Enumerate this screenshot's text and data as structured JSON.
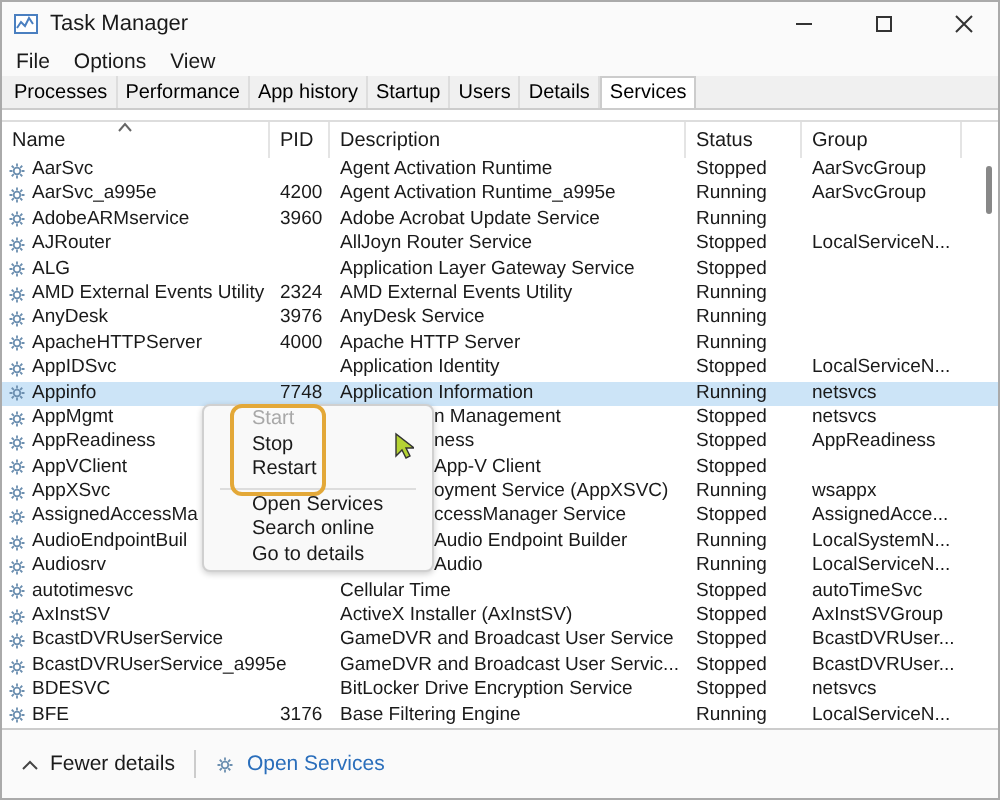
{
  "window": {
    "title": "Task Manager"
  },
  "menu_bar": [
    "File",
    "Options",
    "View"
  ],
  "tabs": [
    {
      "label": "Processes",
      "selected": false
    },
    {
      "label": "Performance",
      "selected": false
    },
    {
      "label": "App history",
      "selected": false
    },
    {
      "label": "Startup",
      "selected": false
    },
    {
      "label": "Users",
      "selected": false
    },
    {
      "label": "Details",
      "selected": false
    },
    {
      "label": "Services",
      "selected": true
    }
  ],
  "table": {
    "columns": [
      "Name",
      "PID",
      "Description",
      "Status",
      "Group"
    ],
    "rows": [
      {
        "name": "AarSvc",
        "pid": "",
        "description": "Agent Activation Runtime",
        "status": "Stopped",
        "group": "AarSvcGroup",
        "selected": false
      },
      {
        "name": "AarSvc_a995e",
        "pid": "4200",
        "description": "Agent Activation Runtime_a995e",
        "status": "Running",
        "group": "AarSvcGroup",
        "selected": false
      },
      {
        "name": "AdobeARMservice",
        "pid": "3960",
        "description": "Adobe Acrobat Update Service",
        "status": "Running",
        "group": "",
        "selected": false
      },
      {
        "name": "AJRouter",
        "pid": "",
        "description": "AllJoyn Router Service",
        "status": "Stopped",
        "group": "LocalServiceN...",
        "selected": false
      },
      {
        "name": "ALG",
        "pid": "",
        "description": "Application Layer Gateway Service",
        "status": "Stopped",
        "group": "",
        "selected": false
      },
      {
        "name": "AMD External Events Utility",
        "pid": "2324",
        "description": "AMD External Events Utility",
        "status": "Running",
        "group": "",
        "selected": false
      },
      {
        "name": "AnyDesk",
        "pid": "3976",
        "description": "AnyDesk Service",
        "status": "Running",
        "group": "",
        "selected": false
      },
      {
        "name": "ApacheHTTPServer",
        "pid": "4000",
        "description": "Apache HTTP Server",
        "status": "Running",
        "group": "",
        "selected": false
      },
      {
        "name": "AppIDSvc",
        "pid": "",
        "description": "Application Identity",
        "status": "Stopped",
        "group": "LocalServiceN...",
        "selected": false
      },
      {
        "name": "Appinfo",
        "pid": "7748",
        "description": "Application Information",
        "status": "Running",
        "group": "netsvcs",
        "selected": true
      },
      {
        "name": "AppMgmt",
        "pid": "",
        "description": "n Management",
        "status": "Stopped",
        "group": "netsvcs",
        "selected": false
      },
      {
        "name": "AppReadiness",
        "pid": "",
        "description": "ness",
        "status": "Stopped",
        "group": "AppReadiness",
        "selected": false
      },
      {
        "name": "AppVClient",
        "pid": "",
        "description": "App-V Client",
        "status": "Stopped",
        "group": "",
        "selected": false
      },
      {
        "name": "AppXSvc",
        "pid": "",
        "description": "oyment Service (AppXSVC)",
        "status": "Running",
        "group": "wsappx",
        "selected": false
      },
      {
        "name": "AssignedAccessMa",
        "pid": "",
        "description": "ccessManager Service",
        "status": "Stopped",
        "group": "AssignedAcce...",
        "selected": false
      },
      {
        "name": "AudioEndpointBuil",
        "pid": "",
        "description": "Audio Endpoint Builder",
        "status": "Running",
        "group": "LocalSystemN...",
        "selected": false
      },
      {
        "name": "Audiosrv",
        "pid": "",
        "description": "Audio",
        "status": "Running",
        "group": "LocalServiceN...",
        "selected": false
      },
      {
        "name": "autotimesvc",
        "pid": "",
        "description": "Cellular Time",
        "status": "Stopped",
        "group": "autoTimeSvc",
        "selected": false
      },
      {
        "name": "AxInstSV",
        "pid": "",
        "description": "ActiveX Installer (AxInstSV)",
        "status": "Stopped",
        "group": "AxInstSVGroup",
        "selected": false
      },
      {
        "name": "BcastDVRUserService",
        "pid": "",
        "description": "GameDVR and Broadcast User Service",
        "status": "Stopped",
        "group": "BcastDVRUser...",
        "selected": false
      },
      {
        "name": "BcastDVRUserService_a995e",
        "pid": "",
        "description": "GameDVR and Broadcast User Servic...",
        "status": "Stopped",
        "group": "BcastDVRUser...",
        "selected": false
      },
      {
        "name": "BDESVC",
        "pid": "",
        "description": "BitLocker Drive Encryption Service",
        "status": "Stopped",
        "group": "netsvcs",
        "selected": false
      },
      {
        "name": "BFE",
        "pid": "3176",
        "description": "Base Filtering Engine",
        "status": "Running",
        "group": "LocalServiceN...",
        "selected": false
      }
    ]
  },
  "context_menu": {
    "items": [
      {
        "label": "Start",
        "disabled": true,
        "highlighted": true
      },
      {
        "label": "Stop",
        "disabled": false,
        "highlighted": true
      },
      {
        "label": "Restart",
        "disabled": false,
        "highlighted": true
      },
      {
        "kind": "separator"
      },
      {
        "label": "Open Services",
        "disabled": false,
        "highlighted": false
      },
      {
        "label": "Search online",
        "disabled": false,
        "highlighted": false
      },
      {
        "label": "Go to details",
        "disabled": false,
        "highlighted": false
      }
    ]
  },
  "footer": {
    "fewer_details": "Fewer details",
    "open_services": "Open Services"
  }
}
